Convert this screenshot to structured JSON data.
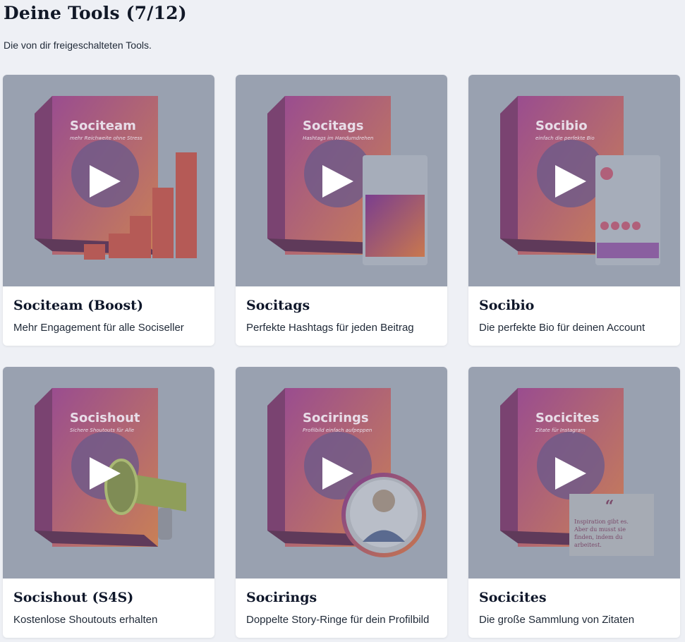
{
  "header": {
    "title": "Deine Tools (7/12)",
    "subtitle": "Die von dir freigeschalteten Tools."
  },
  "cards": [
    {
      "title": "Sociteam (Boost)",
      "description": "Mehr Engagement für alle Sociseller",
      "box_title": "Sociteam",
      "box_tagline": "mehr Reichweite ohne Stress",
      "image": "sociteam-box-with-bars"
    },
    {
      "title": "Socitags",
      "description": "Perfekte Hashtags für jeden Beitrag",
      "box_title": "Socitags",
      "box_tagline": "Hashtags im Handumdrehen",
      "image": "socitags-box-with-phone"
    },
    {
      "title": "Socibio",
      "description": "Die perfekte Bio für deinen Account",
      "box_title": "Socibio",
      "box_tagline": "einfach die perfekte Bio",
      "image": "socibio-box-with-profile"
    },
    {
      "title": "Socishout (S4S)",
      "description": "Kostenlose Shoutouts erhalten",
      "box_title": "Socishout",
      "box_tagline": "Sichere Shoutouts für Alle",
      "image": "socishout-box-with-megaphone"
    },
    {
      "title": "Socirings",
      "description": "Doppelte Story-Ringe für dein Profilbild",
      "box_title": "Socirings",
      "box_tagline": "Profilbild einfach aufpeppen",
      "image": "socirings-box-with-portrait"
    },
    {
      "title": "Socicites",
      "description": "Die große Sammlung von Zitaten",
      "box_title": "Socicites",
      "box_tagline": "Zitate für Instagram",
      "image": "socicites-box-with-quote",
      "quote": "Inspiration gibt es. Aber du musst sie finden, indem du arbeitest."
    }
  ],
  "colors": {
    "overlay": "#99a1b0",
    "box_pink": "#c0507e",
    "box_orange": "#d0703e",
    "play": "#ffffff"
  }
}
